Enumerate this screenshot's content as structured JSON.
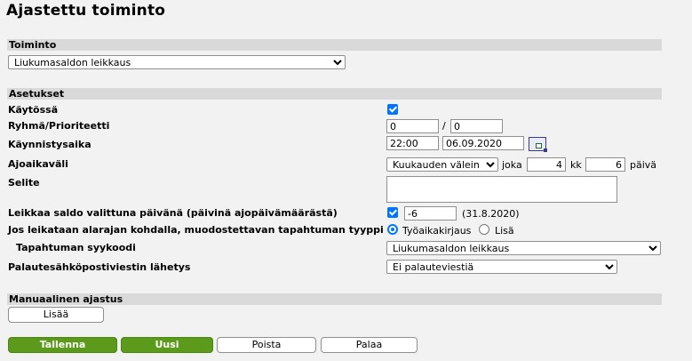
{
  "page": {
    "title": "Ajastettu toiminto"
  },
  "toiminto": {
    "section_title": "Toiminto",
    "selected": "Liukumasaldon leikkaus"
  },
  "asetukset": {
    "section_title": "Asetukset",
    "kaytossa_label": "Käytössä",
    "kaytossa_checked": true,
    "ryhma_label": "Ryhmä/Prioriteetti",
    "ryhma_value": "0",
    "ryhma_separator": "/",
    "prioriteetti_value": "0",
    "kaynnistysaika_label": "Käynnistysaika",
    "time_value": "22:00",
    "date_value": "06.09.2020",
    "ajoaikavali_label": "Ajoaikaväli",
    "interval_selected": "Kuukauden välein",
    "joka_label": "joka",
    "months_value": "4",
    "kk_label": "kk",
    "days_value": "6",
    "paiva_label": "päivä",
    "selite_label": "Selite",
    "selite_value": "",
    "leikkaa_label": "Leikkaa saldo valittuna päivänä (päivinä ajopäivämäärästä)",
    "leikkaa_checked": true,
    "leikkaa_value": "-6",
    "leikkaa_date_note": "(31.8.2020)",
    "tyyppi_label": "Jos leikataan alarajan kohdalla, muodostettavan tapahtuman tyyppi",
    "radio_option_1": "Työaikakirjaus",
    "radio_option_2": "Lisä",
    "radio_selected": "Työaikakirjaus",
    "syykoodi_label": "Tapahtuman syykoodi",
    "syykoodi_selected": "Liukumasaldon leikkaus",
    "palaute_label": "Palautesähköpostiviestin lähetys",
    "palaute_selected": "Ei palauteviestiä"
  },
  "manuaalinen": {
    "section_title": "Manuaalinen ajastus",
    "lisaa_label": "Lisää"
  },
  "actions": {
    "tallenna": "Tallenna",
    "uusi": "Uusi",
    "poista": "Poista",
    "palaa": "Palaa"
  },
  "colors": {
    "accent_blue": "#0075ff",
    "button_green": "#5c9a1b",
    "section_bar": "#d9d9d9",
    "page_bg": "#f2f2f2"
  }
}
